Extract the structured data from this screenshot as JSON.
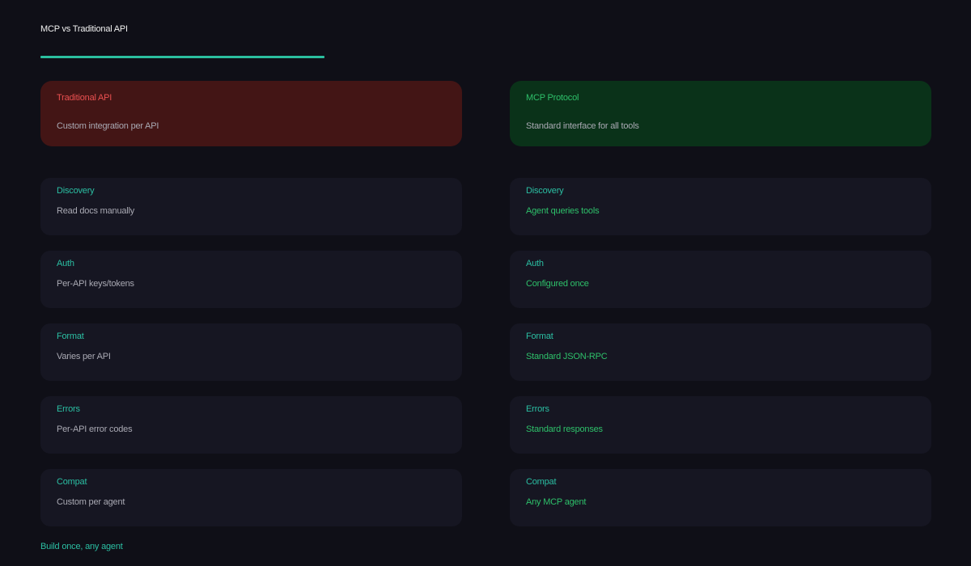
{
  "title": "MCP vs Traditional API",
  "colors": {
    "background": "#0f0f17",
    "accent": "#2bbf9f",
    "traditional_header_bg": "#431515",
    "traditional_accent": "#ea5050",
    "mcp_header_bg": "#0a3219",
    "mcp_accent": "#2ec06a",
    "card_bg": "#161622",
    "muted_text": "#a9a9b3"
  },
  "traditional": {
    "name": "Traditional API",
    "description": "Custom integration per API",
    "rows": [
      {
        "label": "Discovery",
        "value": "Read docs manually"
      },
      {
        "label": "Auth",
        "value": "Per-API keys/tokens"
      },
      {
        "label": "Format",
        "value": "Varies per API"
      },
      {
        "label": "Errors",
        "value": "Per-API error codes"
      },
      {
        "label": "Compat",
        "value": "Custom per agent"
      }
    ]
  },
  "mcp": {
    "name": "MCP Protocol",
    "description": "Standard interface for all tools",
    "rows": [
      {
        "label": "Discovery",
        "value": "Agent queries tools"
      },
      {
        "label": "Auth",
        "value": "Configured once"
      },
      {
        "label": "Format",
        "value": "Standard JSON-RPC"
      },
      {
        "label": "Errors",
        "value": "Standard responses"
      },
      {
        "label": "Compat",
        "value": "Any MCP agent"
      }
    ]
  },
  "footer": "Build once, any agent"
}
